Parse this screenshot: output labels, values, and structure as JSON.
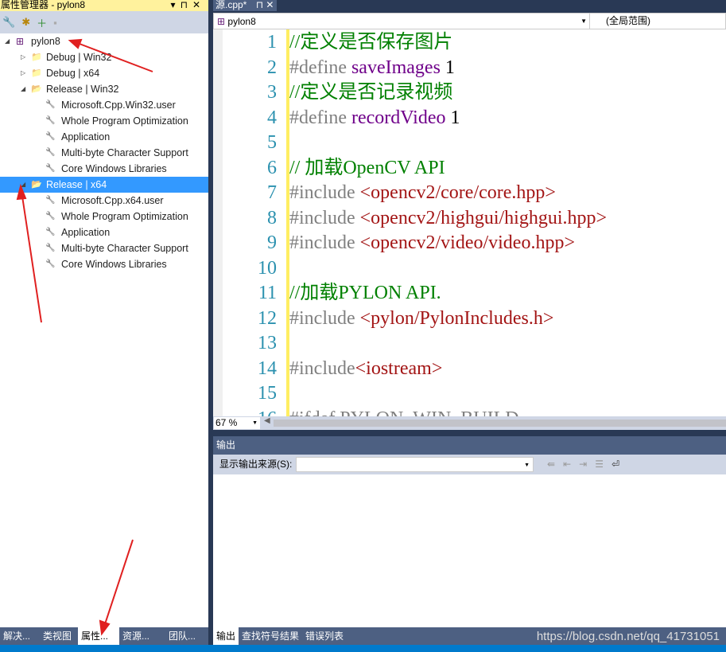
{
  "property_manager": {
    "title": "属性管理器 - pylon8",
    "title_buttons": [
      "▾",
      "⊓",
      "✕"
    ],
    "tree": [
      {
        "label": "pylon8",
        "level": 0,
        "expanded": true,
        "icon": "project-icon"
      },
      {
        "label": "Debug | Win32",
        "level": 1,
        "expanded": false,
        "icon": "folder-icon"
      },
      {
        "label": "Debug | x64",
        "level": 1,
        "expanded": false,
        "icon": "folder-icon"
      },
      {
        "label": "Release | Win32",
        "level": 1,
        "expanded": true,
        "icon": "folder-open-icon"
      },
      {
        "label": "Microsoft.Cpp.Win32.user",
        "level": 2,
        "icon": "wrench-icon"
      },
      {
        "label": "Whole Program Optimization",
        "level": 2,
        "icon": "wrench-icon"
      },
      {
        "label": "Application",
        "level": 2,
        "icon": "wrench-icon"
      },
      {
        "label": "Multi-byte Character Support",
        "level": 2,
        "icon": "wrench-icon"
      },
      {
        "label": "Core Windows Libraries",
        "level": 2,
        "icon": "wrench-icon"
      },
      {
        "label": "Release | x64",
        "level": 1,
        "expanded": true,
        "selected": true,
        "icon": "folder-open-icon"
      },
      {
        "label": "Microsoft.Cpp.x64.user",
        "level": 2,
        "icon": "wrench-icon"
      },
      {
        "label": "Whole Program Optimization",
        "level": 2,
        "icon": "wrench-icon"
      },
      {
        "label": "Application",
        "level": 2,
        "icon": "wrench-icon"
      },
      {
        "label": "Multi-byte Character Support",
        "level": 2,
        "icon": "wrench-icon"
      },
      {
        "label": "Core Windows Libraries",
        "level": 2,
        "icon": "wrench-icon"
      }
    ],
    "bottom_tabs": [
      "解决...",
      "类视图",
      "属性...",
      "资源...",
      "团队..."
    ],
    "active_tab": 2
  },
  "editor": {
    "tab": "源.cpp*",
    "tab_buttons": [
      "⊓",
      "✕"
    ],
    "project": "pylon8",
    "scope": "(全局范围)",
    "zoom": "67 %",
    "lines": [
      {
        "n": "1",
        "parts": [
          [
            "//定义是否保存图片",
            "#008000"
          ]
        ]
      },
      {
        "n": "2",
        "parts": [
          [
            "#define ",
            "#808080"
          ],
          [
            "saveImages",
            "#6F008A"
          ],
          [
            " 1",
            "#000"
          ]
        ]
      },
      {
        "n": "3",
        "parts": [
          [
            "//定义是否记录视频",
            "#008000"
          ]
        ]
      },
      {
        "n": "4",
        "parts": [
          [
            "#define ",
            "#808080"
          ],
          [
            "recordVideo",
            "#6F008A"
          ],
          [
            " 1",
            "#000"
          ]
        ]
      },
      {
        "n": "5",
        "parts": []
      },
      {
        "n": "6",
        "parts": [
          [
            "// 加载OpenCV API",
            "#008000"
          ]
        ]
      },
      {
        "n": "7",
        "parts": [
          [
            "#include ",
            "#808080"
          ],
          [
            "<opencv2/core/core.hpp>",
            "#A31515"
          ]
        ]
      },
      {
        "n": "8",
        "parts": [
          [
            "#include ",
            "#808080"
          ],
          [
            "<opencv2/highgui/highgui.hpp>",
            "#A31515"
          ]
        ]
      },
      {
        "n": "9",
        "parts": [
          [
            "#include ",
            "#808080"
          ],
          [
            "<opencv2/video/video.hpp>",
            "#A31515"
          ]
        ]
      },
      {
        "n": "10",
        "parts": []
      },
      {
        "n": "11",
        "parts": [
          [
            "//加载PYLON API.",
            "#008000"
          ]
        ]
      },
      {
        "n": "12",
        "parts": [
          [
            "#include ",
            "#808080"
          ],
          [
            "<pylon/PylonIncludes.h>",
            "#A31515"
          ]
        ]
      },
      {
        "n": "13",
        "parts": []
      },
      {
        "n": "14",
        "parts": [
          [
            "#include",
            "#808080"
          ],
          [
            "<iostream>",
            "#A31515"
          ]
        ]
      },
      {
        "n": "15",
        "parts": []
      },
      {
        "n": "16",
        "parts": [
          [
            "#ifdef PYLON_WIN_BUILD",
            "#808080"
          ]
        ]
      }
    ]
  },
  "output": {
    "title": "输出",
    "source_label": "显示输出来源(S):",
    "source_value": "",
    "tabs": [
      "输出",
      "查找符号结果",
      "错误列表"
    ],
    "active_tab": 0
  },
  "watermark": "https://blog.csdn.net/qq_41731051",
  "colors": {
    "selection": "#3399FF",
    "accent": "#007ACC",
    "panel": "#4D6082",
    "annotation": "#E02020"
  }
}
